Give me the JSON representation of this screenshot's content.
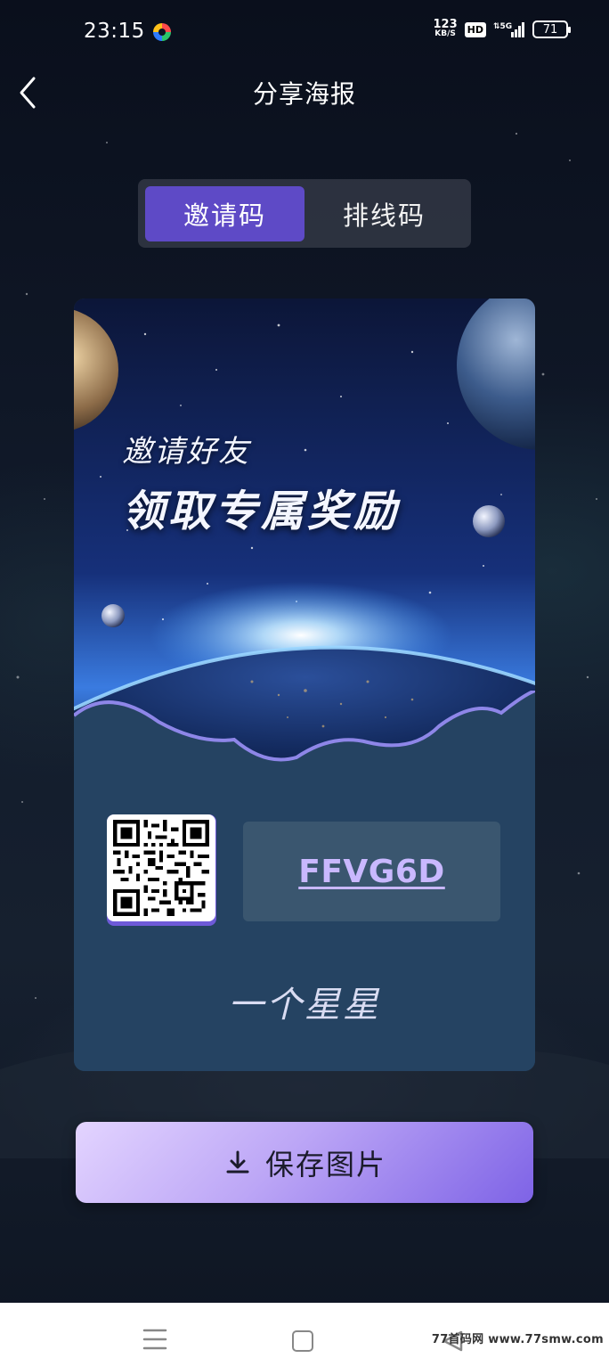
{
  "status_bar": {
    "time": "23:15",
    "net_speed_value": "123",
    "net_speed_unit": "KB/S",
    "hd_badge": "HD",
    "network": "5G",
    "battery": "71"
  },
  "header": {
    "title": "分享海报"
  },
  "tabs": [
    {
      "label": "邀请码",
      "active": true
    },
    {
      "label": "排线码",
      "active": false
    }
  ],
  "poster": {
    "headline_1": "邀请好友",
    "headline_2": "领取专属奖励",
    "invite_code": "FFVG6D",
    "nickname": "一个星星"
  },
  "actions": {
    "save_label": "保存图片"
  },
  "watermark": "77首码网 www.77smw.com",
  "colors": {
    "accent": "#5e4ac6",
    "invite_code": "#c9b8ff",
    "poster_bottom": "#254362"
  }
}
